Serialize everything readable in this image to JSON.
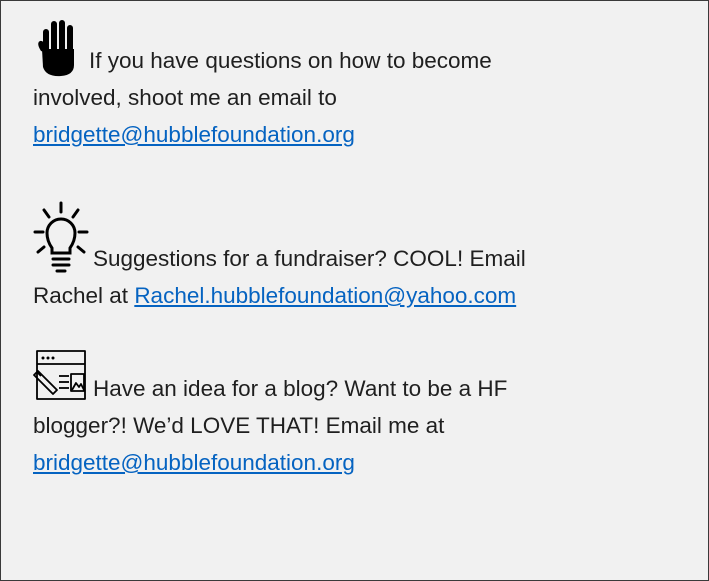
{
  "blocks": [
    {
      "icon": "hand-stop-icon",
      "line1": "If you have questions on how to become",
      "line2": "involved, shoot me an email to",
      "email": "bridgette@hubblefoundation.org"
    },
    {
      "icon": "lightbulb-icon",
      "line1": "Suggestions for a fundraiser? COOL! Email",
      "line2_prefix": "Rachel at ",
      "email": "Rachel.hubblefoundation@yahoo.com"
    },
    {
      "icon": "blog-editor-icon",
      "line1": "Have an idea for a blog? Want to be a HF",
      "line2": "blogger?! We’d LOVE THAT! Email me at",
      "email": "bridgette@hubblefoundation.org"
    }
  ],
  "colors": {
    "background": "#f1f1f1",
    "border": "#3a3a3a",
    "text": "#1f1f1f",
    "link": "#0563c1"
  }
}
